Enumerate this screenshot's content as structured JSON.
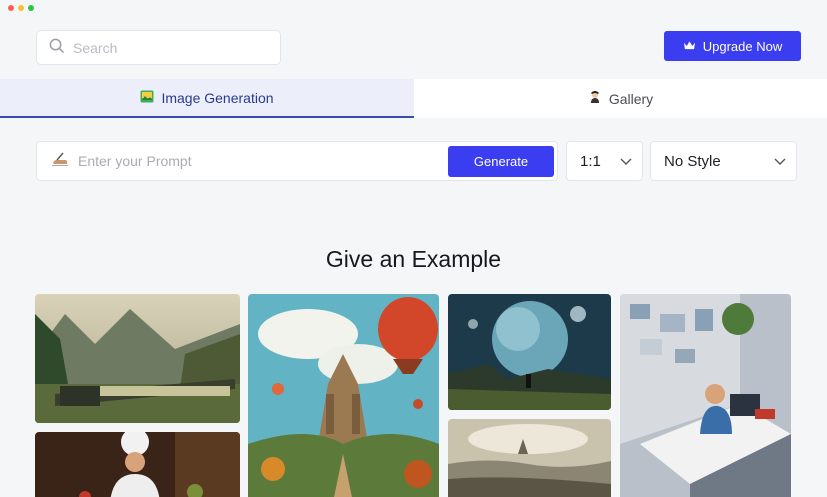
{
  "window": {
    "dots": [
      "#ff5f57",
      "#febc2e",
      "#28c840"
    ]
  },
  "header": {
    "search": {
      "placeholder": "Search"
    },
    "upgrade_label": "Upgrade Now"
  },
  "tabs": [
    {
      "label": "Image Generation",
      "active": true,
      "icon": "image-icon"
    },
    {
      "label": "Gallery",
      "active": false,
      "icon": "painter-icon"
    }
  ],
  "prompt_bar": {
    "placeholder": "Enter your Prompt",
    "generate_label": "Generate",
    "ratio": {
      "selected": "1:1"
    },
    "style": {
      "selected": "No Style"
    }
  },
  "examples": {
    "heading": "Give an Example",
    "images": [
      {
        "subject": "train-in-mountain-valley"
      },
      {
        "subject": "chef-cooking"
      },
      {
        "subject": "fantasy-castle-with-balloons"
      },
      {
        "subject": "planet-over-landscape"
      },
      {
        "subject": "misty-sea-scene"
      },
      {
        "subject": "isometric-office"
      }
    ]
  },
  "colors": {
    "accent": "#3a3df0",
    "tab_active_bg": "#eceffa",
    "tab_active_text": "#2a3a8c"
  }
}
